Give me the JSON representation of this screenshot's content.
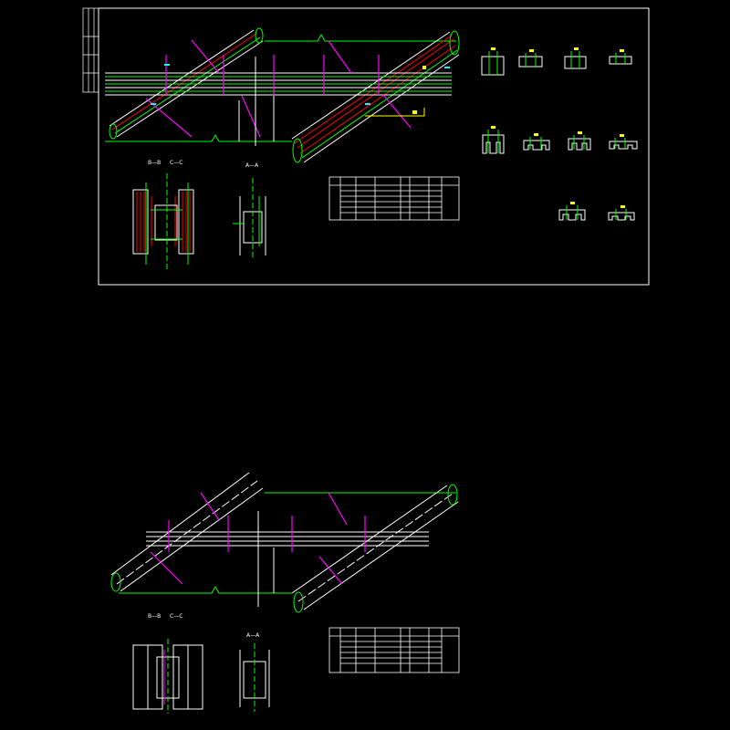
{
  "sections": {
    "top": {
      "section_a": "A—A",
      "section_b": "B—B",
      "section_c": "C—C"
    },
    "bottom": {
      "section_a": "A—A",
      "section_b": "B—B",
      "section_c": "C—C"
    }
  },
  "colors": {
    "background": "#000000",
    "outline": "#ffffff",
    "green": "#00ff00",
    "red": "#ff0000",
    "magenta": "#ff00ff",
    "yellow": "#ffff00",
    "cyan": "#00ffff"
  }
}
